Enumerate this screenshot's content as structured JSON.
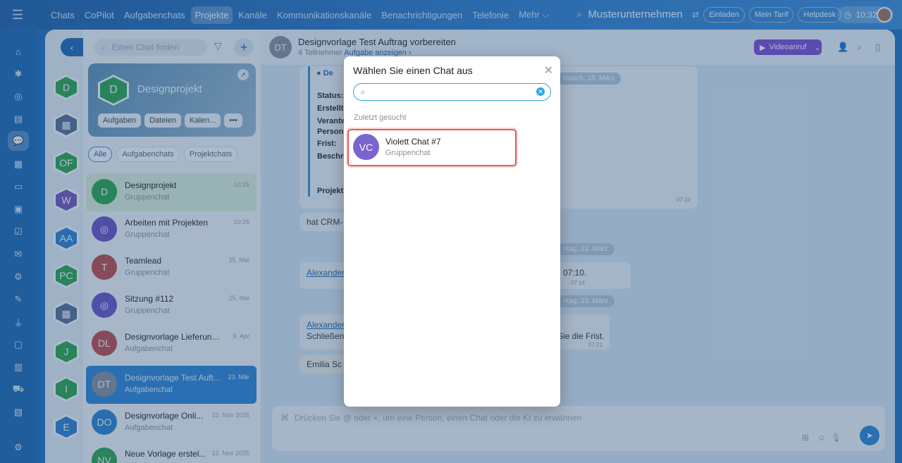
{
  "topbar": {
    "nav": [
      "Chats",
      "CoPilot",
      "Aufgabenchats",
      "Projekte",
      "Kanäle",
      "Kommunikationskanäle",
      "Benachrichtigungen",
      "Telefonie",
      "Mehr ⌵"
    ],
    "active_nav": "Projekte",
    "company": "Musterunternehmen",
    "invite": "Einladen",
    "tariff": "Mein Tarif",
    "helpdesk": "Helpdesk",
    "time": "10:32"
  },
  "sidebar": {
    "search_placeholder": "Einen Chat finden",
    "group_card": {
      "avatar": "D",
      "title": "Designprojekt",
      "buttons": [
        "Aufgaben",
        "Dateien",
        "Kalen...",
        "•••"
      ]
    },
    "filters": [
      "Alle",
      "Aufgabenchats",
      "Projektchats"
    ],
    "hex_avatars": [
      "D",
      "",
      "OF",
      "W",
      "AA",
      "PC",
      "",
      "J",
      "I",
      "E"
    ],
    "hex_colors": [
      "#2aa44a",
      "#556b8e",
      "#2aa44a",
      "#7453b8",
      "#2a7fd0",
      "#2aa44a",
      "#556b8e",
      "#2aa44a",
      "#2aa44a",
      "#2a7fd0"
    ],
    "chats": [
      {
        "avatar": "D",
        "name": "Designprojekt",
        "sub": "Gruppenchat",
        "time": "10:26",
        "color": "#2aa44a"
      },
      {
        "avatar": "",
        "name": "Arbeiten mit Projekten",
        "sub": "Gruppenchat",
        "time": "10:26",
        "color": "#6a4fc4"
      },
      {
        "avatar": "T",
        "name": "Teamlead",
        "sub": "Gruppenchat",
        "time": "25. Mai",
        "color": "#c0474a"
      },
      {
        "avatar": "",
        "name": "Sitzung #112",
        "sub": "Gruppenchat",
        "time": "25. Mai",
        "color": "#6a4fc4"
      },
      {
        "avatar": "DL",
        "name": "Designvorlage Lieferung ...",
        "sub": "Aufgabenchat",
        "time": "9. Apr",
        "color": "#c0474a"
      },
      {
        "avatar": "DT",
        "name": "Designvorlage Test Auft...",
        "sub": "Aufgabenchat",
        "time": "23. Mär",
        "color": "#8a8f97"
      },
      {
        "avatar": "DO",
        "name": "Designvorlage Onli...",
        "sub": "Aufgabenchat",
        "time": "22. Nov 2025",
        "color": "#2a7fd0"
      },
      {
        "avatar": "NV",
        "name": "Neue Vorlage erstel...",
        "sub": "Aufgabenchat",
        "time": "12. Nov 2025",
        "color": "#2aa44a"
      }
    ]
  },
  "chat": {
    "avatar": "DT",
    "title": "Designvorlage Test Auftrag vorbereiten",
    "participants": "4 Teilnehmer",
    "task_link": "Aufgabe anzeigen ›",
    "video_button": "Videoanruf",
    "card_header": "De",
    "fields": [
      "Status:",
      "Erstellt",
      "Verantw",
      "Person:",
      "Frist:",
      "Beschre",
      "Projekt:"
    ],
    "card_time": "07:10",
    "date1": "ttwoch, 18. März",
    "msg_crm": "hat CRM-",
    "date2": "ntag, 22. März",
    "msg_alex1": "Alexander",
    "msg_time1": "07:10.",
    "msg_time1_small": "07:14",
    "date3": "ntag, 23. März",
    "msg_alex2": "Alexander",
    "msg_close": "Schließen",
    "msg_frist": "Sie die Frist.",
    "msg_time2": "07:21",
    "msg_emilia": "Emilia Sc",
    "input_placeholder": "Drücken Sie @ oder +, um eine Person, einen Chat oder die KI zu erwähnen"
  },
  "modal": {
    "title": "Wählen Sie einen Chat aus",
    "search_value": "",
    "recent_label": "Zuletzt gesucht",
    "result": {
      "avatar": "VC",
      "name": "Violett Chat #7",
      "sub": "Gruppenchat"
    }
  }
}
